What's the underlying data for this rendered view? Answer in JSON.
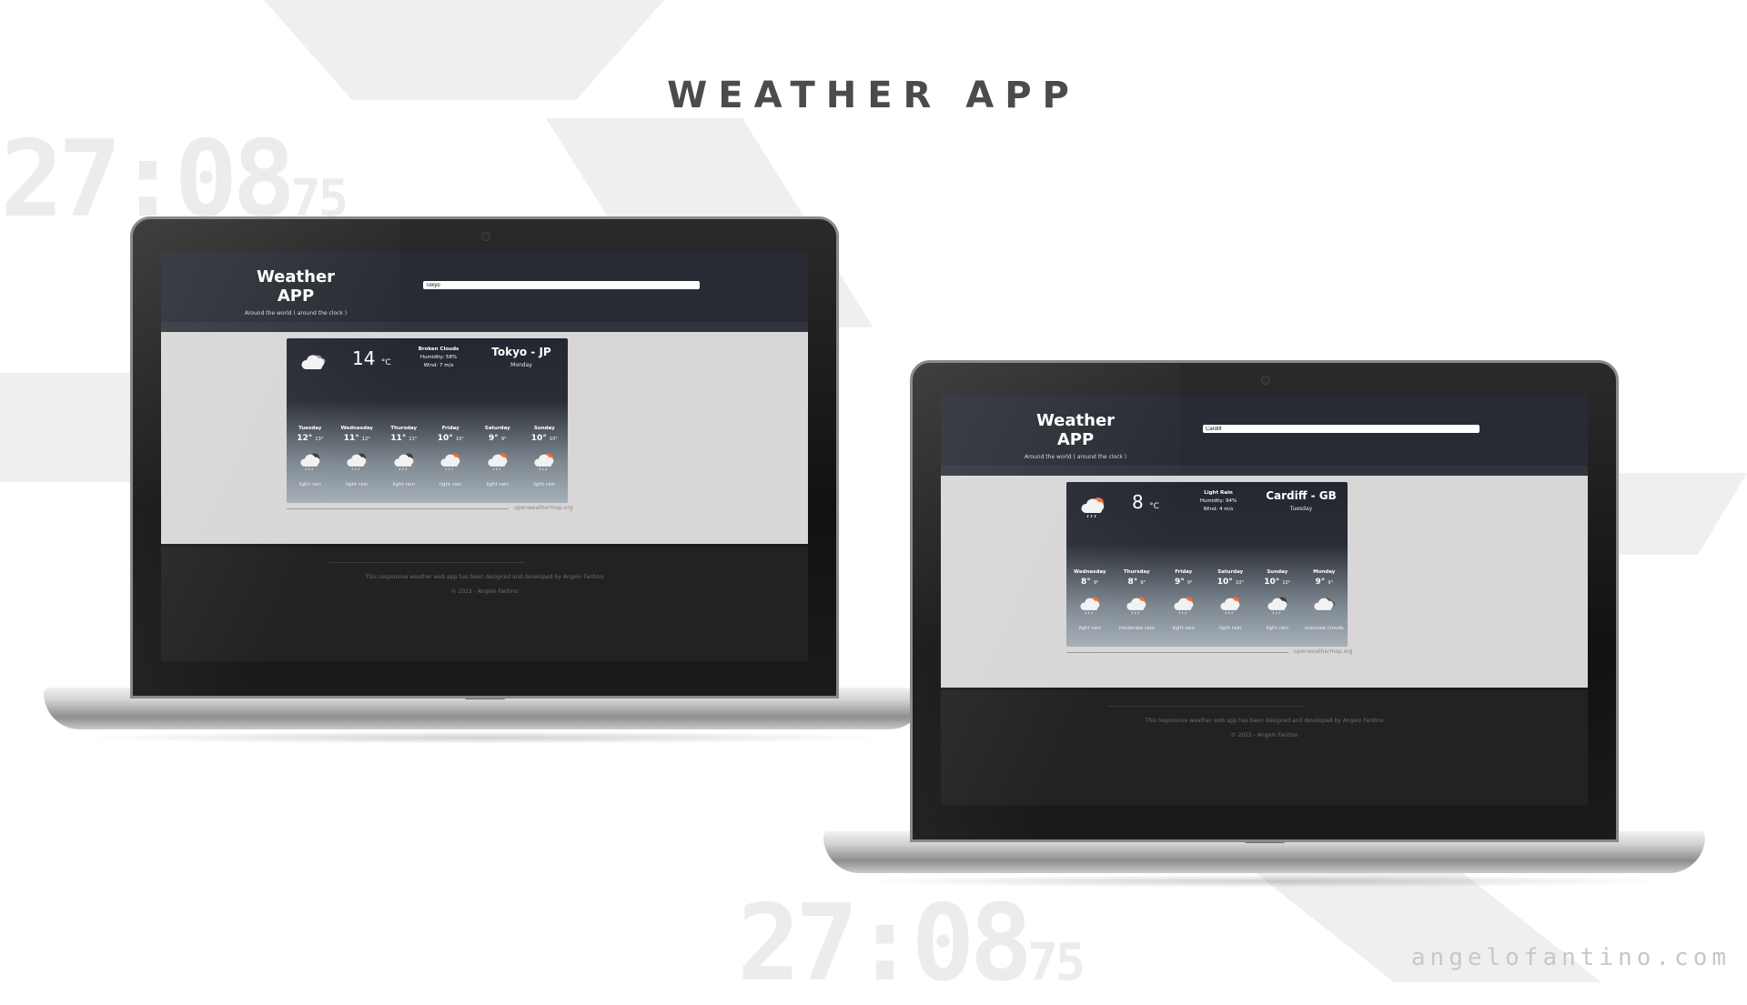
{
  "poster": {
    "title": "WEATHER APP",
    "site": "angelofantino.com",
    "bg_digits": "27:08",
    "bg_digits_small": "75"
  },
  "laptops": [
    {
      "app_title": "Weather APP",
      "app_subtitle": "Around the world ( around the clock )",
      "search_value": "Tokyo",
      "current": {
        "icon": "broken-clouds-icon",
        "temp": "14",
        "unit": "°C",
        "condition": "Broken Clouds",
        "humidity": "Humidity: 58%",
        "wind": "Wind: 7 m/s",
        "city": "Tokyo - JP",
        "day": "Monday"
      },
      "forecast": [
        {
          "day": "Tuesday",
          "max": "12°",
          "min": "13°",
          "icon": "rain-cloud-icon",
          "desc": "light rain"
        },
        {
          "day": "Wednesday",
          "max": "11°",
          "min": "12°",
          "icon": "rain-cloud-icon",
          "desc": "light rain"
        },
        {
          "day": "Thursday",
          "max": "11°",
          "min": "11°",
          "icon": "rain-cloud-icon",
          "desc": "light rain"
        },
        {
          "day": "Friday",
          "max": "10°",
          "min": "10°",
          "icon": "rain-sun-icon",
          "desc": "light rain"
        },
        {
          "day": "Saturday",
          "max": "9°",
          "min": "9°",
          "icon": "rain-sun-icon",
          "desc": "light rain"
        },
        {
          "day": "Sunday",
          "max": "10°",
          "min": "10°",
          "icon": "rain-sun-icon",
          "desc": "light rain"
        }
      ],
      "credit": "openweathermap.org",
      "footer_text": "This responsive weather web app has been designed and developed by Angelo Fantino",
      "footer_copy": "© 2022 - Angelo Fantino"
    },
    {
      "app_title": "Weather APP",
      "app_subtitle": "Around the world ( around the clock )",
      "search_value": "Cardiff",
      "current": {
        "icon": "rain-sun-icon",
        "temp": "8",
        "unit": "°C",
        "condition": "Light Rain",
        "humidity": "Humidity: 94%",
        "wind": "Wind: 4 m/s",
        "city": "Cardiff - GB",
        "day": "Tuesday"
      },
      "forecast": [
        {
          "day": "Wednesday",
          "max": "8°",
          "min": "9°",
          "icon": "rain-sun-icon",
          "desc": "light rain"
        },
        {
          "day": "Thursday",
          "max": "8°",
          "min": "9°",
          "icon": "rain-sun-icon",
          "desc": "moderate rain"
        },
        {
          "day": "Friday",
          "max": "9°",
          "min": "9°",
          "icon": "rain-sun-icon",
          "desc": "light rain"
        },
        {
          "day": "Saturday",
          "max": "10°",
          "min": "10°",
          "icon": "rain-sun-icon",
          "desc": "light rain"
        },
        {
          "day": "Sunday",
          "max": "10°",
          "min": "10°",
          "icon": "rain-cloud-icon",
          "desc": "light rain"
        },
        {
          "day": "Monday",
          "max": "9°",
          "min": "9°",
          "icon": "overcast-clouds-icon",
          "desc": "overcast clouds"
        }
      ],
      "credit": "openweathermap.org",
      "footer_text": "This responsive weather web app has been designed and developed by Angelo Fantino",
      "footer_copy": "© 2022 - Angelo Fantino"
    }
  ]
}
